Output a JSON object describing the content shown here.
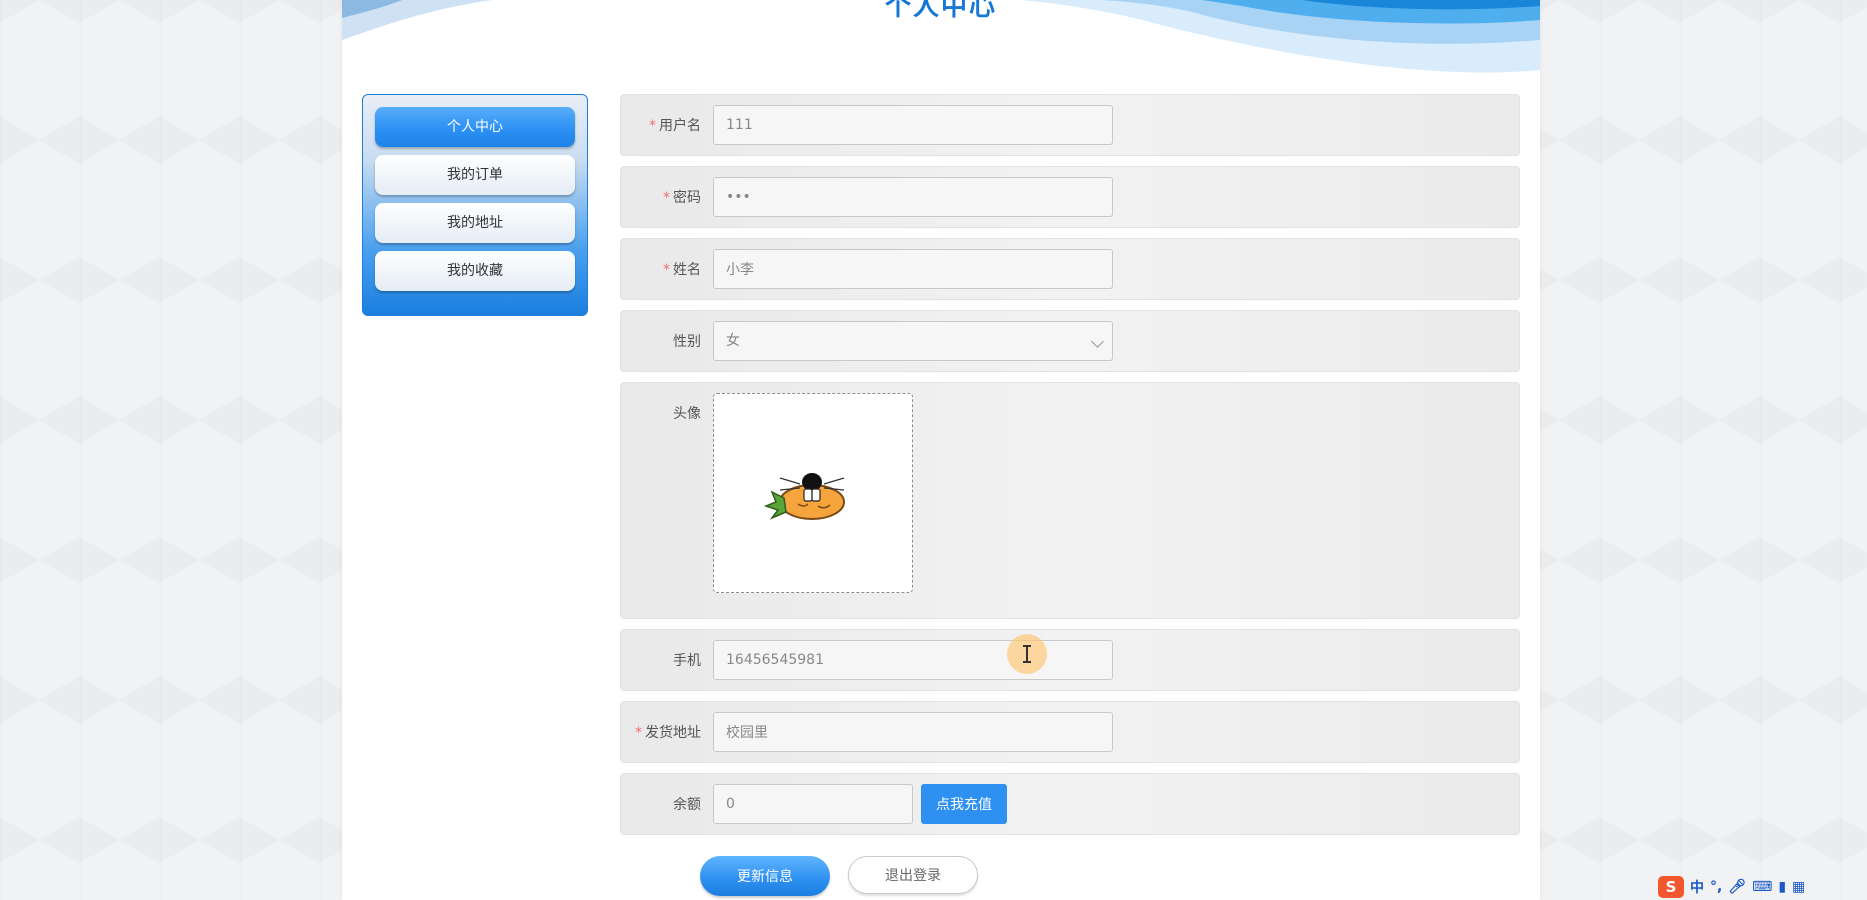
{
  "page": {
    "title": "个人中心"
  },
  "sidebar": {
    "items": [
      {
        "label": "个人中心",
        "active": true
      },
      {
        "label": "我的订单",
        "active": false
      },
      {
        "label": "我的地址",
        "active": false
      },
      {
        "label": "我的收藏",
        "active": false
      }
    ]
  },
  "form": {
    "username": {
      "label": "用户名",
      "required": true,
      "value": "111"
    },
    "password": {
      "label": "密码",
      "required": true,
      "value": "•••"
    },
    "name": {
      "label": "姓名",
      "required": true,
      "value": "小李"
    },
    "gender": {
      "label": "性别",
      "required": false,
      "value": "女"
    },
    "avatar": {
      "label": "头像",
      "required": false
    },
    "phone": {
      "label": "手机",
      "required": false,
      "value": "16456545981"
    },
    "address": {
      "label": "发货地址",
      "required": true,
      "value": "校园里"
    },
    "balance": {
      "label": "余额",
      "required": false,
      "value": "0",
      "recharge_label": "点我充值"
    }
  },
  "actions": {
    "update_label": "更新信息",
    "logout_label": "退出登录"
  },
  "ime": {
    "logo": "S",
    "mode": "中",
    "punct": "°,"
  },
  "colors": {
    "primary": "#2e90f0",
    "required": "#f56c6c",
    "title": "#1677d6"
  }
}
